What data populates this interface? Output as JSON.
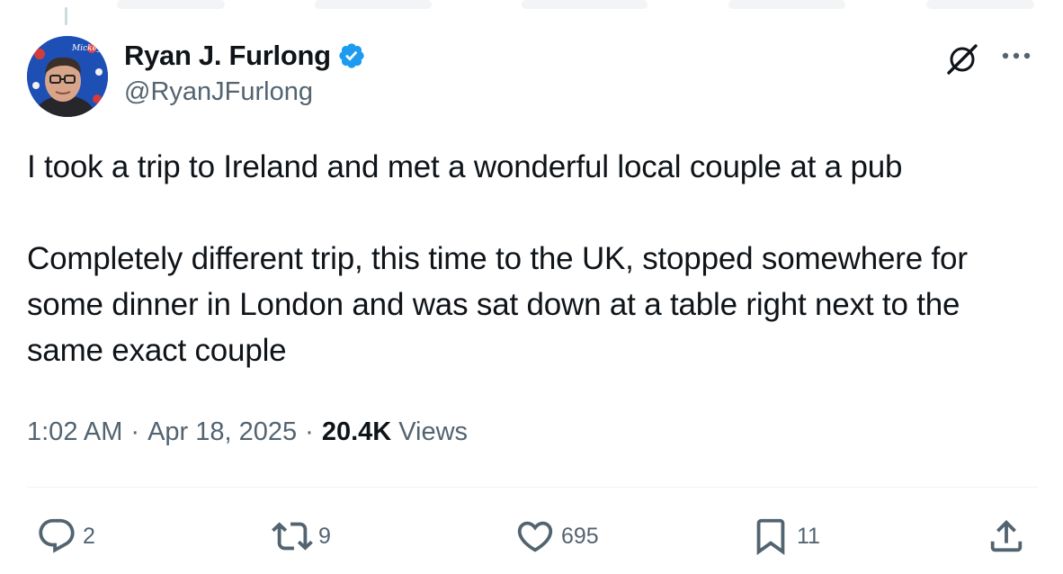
{
  "author": {
    "display_name": "Ryan J. Furlong",
    "handle": "@RyanJFurlong",
    "verified": true,
    "avatar_caption": "Mickey"
  },
  "tweet": {
    "paragraphs": [
      "I took a trip to Ireland and met a wonderful local couple at a pub",
      "Completely different trip, this time to the UK, stopped somewhere for some dinner in London and was sat down at a table right next to the same exact couple"
    ]
  },
  "meta": {
    "time": "1:02 AM",
    "separator": "·",
    "date": "Apr 18, 2025",
    "views_count": "20.4K",
    "views_label": "Views"
  },
  "actions": {
    "replies": "2",
    "reposts": "9",
    "likes": "695",
    "bookmarks": "11"
  },
  "icons": {
    "verified": "verified-badge-icon",
    "grok": "grok-icon",
    "more": "more-horizontal-icon",
    "reply": "reply-icon",
    "repost": "repost-icon",
    "like": "heart-icon",
    "bookmark": "bookmark-icon",
    "share": "share-icon"
  },
  "colors": {
    "text_primary": "#0f1419",
    "text_secondary": "#536471",
    "verified_blue": "#1d9bf0",
    "divider": "#eff3f4"
  }
}
